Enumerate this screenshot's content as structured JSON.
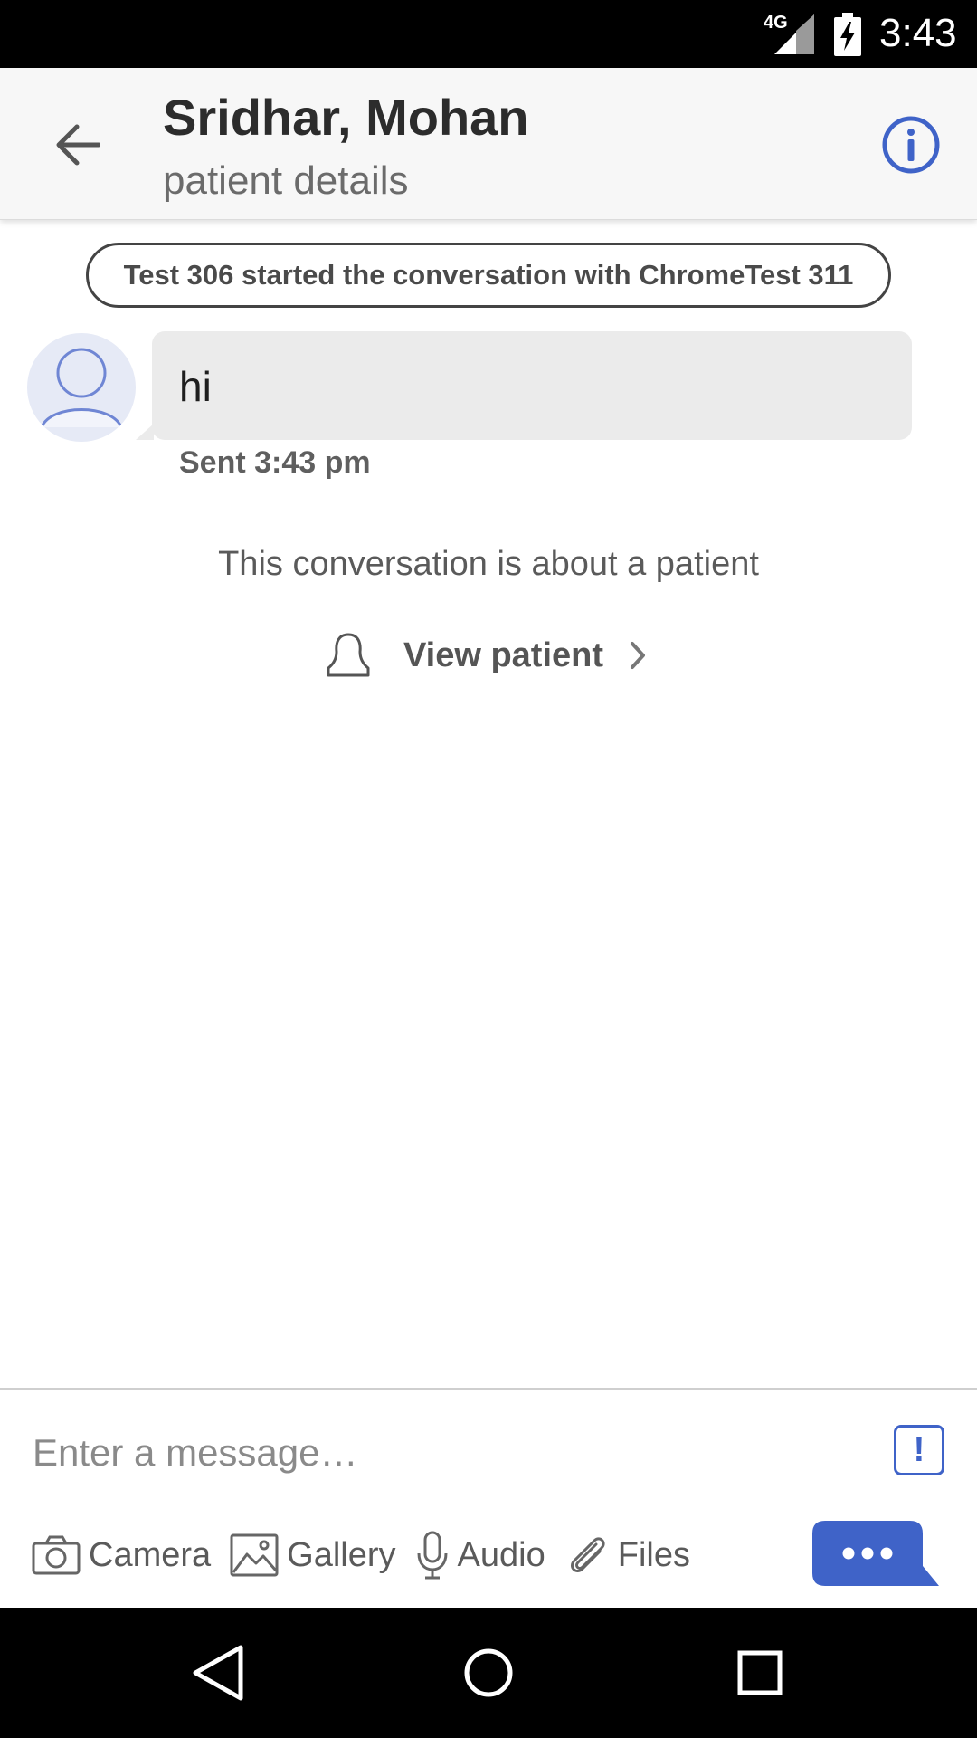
{
  "status_bar": {
    "network": "4G",
    "time": "3:43"
  },
  "header": {
    "title": "Sridhar, Mohan",
    "subtitle": "patient details"
  },
  "conversation": {
    "system_message": "Test 306 started the conversation with ChromeTest 311",
    "messages": [
      {
        "text": "hi",
        "meta": "Sent 3:43 pm"
      }
    ],
    "about_text": "This conversation is about a patient",
    "view_patient_label": "View patient"
  },
  "composer": {
    "placeholder": "Enter a message…",
    "urgent_label": "!",
    "tools": [
      {
        "icon": "camera-icon",
        "label": "Camera"
      },
      {
        "icon": "gallery-icon",
        "label": "Gallery"
      },
      {
        "icon": "microphone-icon",
        "label": "Audio"
      },
      {
        "icon": "paperclip-icon",
        "label": "Files"
      }
    ],
    "send_icon": "more-dots-icon"
  },
  "colors": {
    "accent": "#3f63c8",
    "bubble": "#ebebeb",
    "header_bg": "#f7f7f7"
  }
}
